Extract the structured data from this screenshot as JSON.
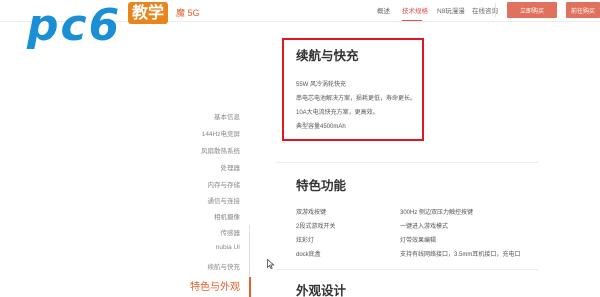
{
  "logo": {
    "brand": "pc6",
    "tag": "教学"
  },
  "header": {
    "product_name": "魔 5G",
    "nav": [
      "概述",
      "技术规格",
      "N8玩漫漫",
      "在线咨询"
    ],
    "active_index": 1,
    "buy_button": "立即购买",
    "second_button": "前往购买"
  },
  "sidebar": {
    "items": [
      "基本信息",
      "144Hz电竞屏",
      "风扇散热系统",
      "处理器",
      "内存与存储",
      "通信与连接",
      "相机摄像",
      "传感器",
      "nubia UI",
      "续航与快充"
    ],
    "active": "特色与外观"
  },
  "battery": {
    "title": "续航与快充",
    "lines": [
      "55W 风冷涡轮快充",
      "串电芯电池解决方案，损耗更低，寿命更长。",
      "10A大电流快充方案，更高效。",
      "典型容量4500mAh"
    ]
  },
  "features": {
    "title": "特色功能",
    "left": [
      "双游戏按键",
      "2段式游戏开关",
      "炫彩灯",
      "dock底盒"
    ],
    "right": [
      "300Hz 侧边双压力触控按键",
      "一键进入游戏模式",
      "灯带效果编辑",
      "支持有线网络接口，3.5mm耳机接口，充电口"
    ]
  },
  "design": {
    "title": "外观设计"
  },
  "colors": {
    "accent": "#e0612d",
    "button": "#e0715c",
    "highlight": "#e0171f",
    "logo": "#1a8fd6"
  },
  "icons": [
    "cursor-icon"
  ]
}
